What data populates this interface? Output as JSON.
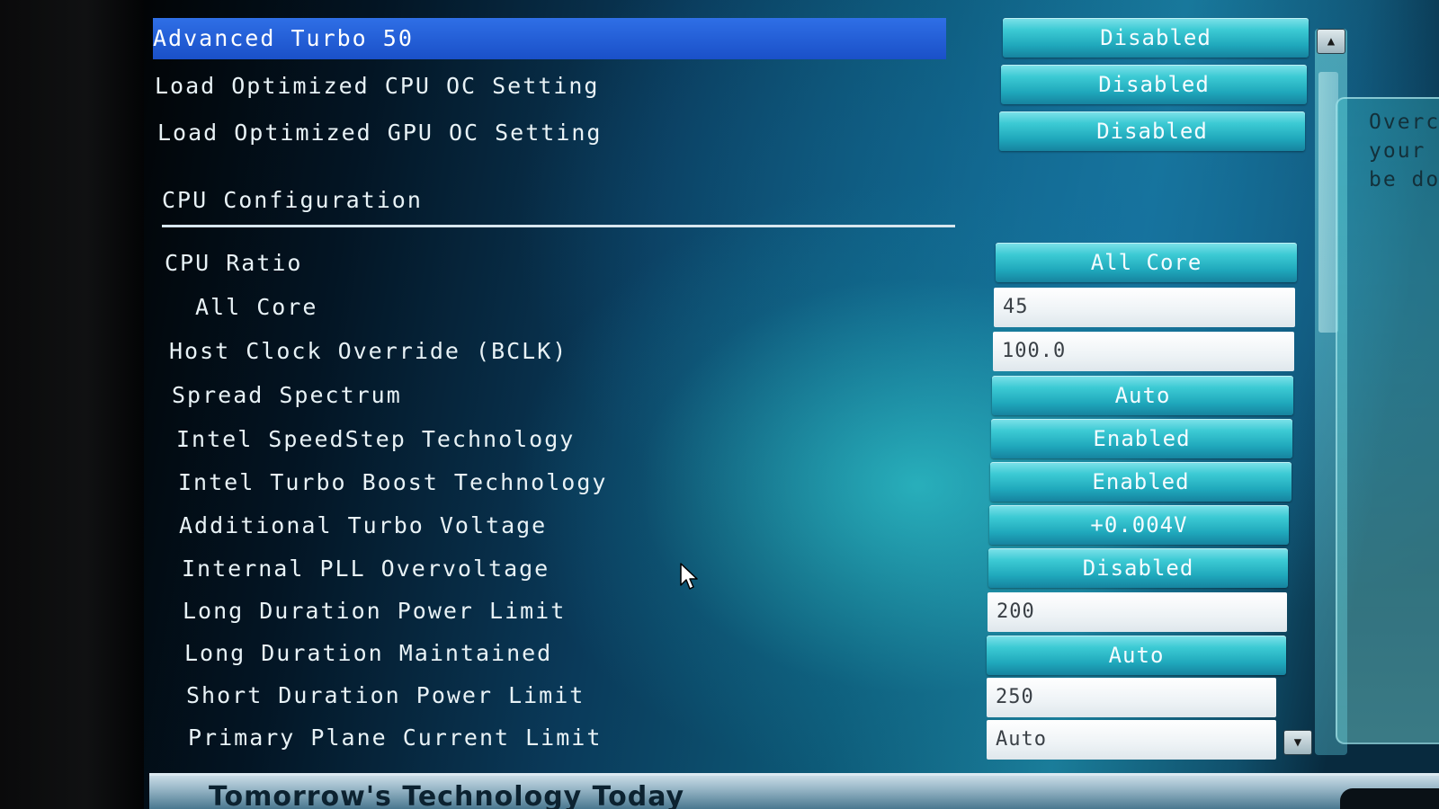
{
  "selected_row": {
    "label": "Advanced Turbo 50",
    "value": "Disabled"
  },
  "top_rows": [
    {
      "label": "Load Optimized CPU OC Setting",
      "value": "Disabled"
    },
    {
      "label": "Load Optimized GPU OC Setting",
      "value": "Disabled"
    }
  ],
  "section": {
    "title": "CPU Configuration"
  },
  "cpu_rows": [
    {
      "label": "CPU Ratio",
      "value": "All Core",
      "kind": "button"
    },
    {
      "label": "All Core",
      "value": "45",
      "kind": "field"
    },
    {
      "label": "Host Clock Override (BCLK)",
      "value": "100.0",
      "kind": "field"
    },
    {
      "label": "Spread Spectrum",
      "value": "Auto",
      "kind": "button"
    },
    {
      "label": "Intel SpeedStep Technology",
      "value": "Enabled",
      "kind": "button"
    },
    {
      "label": "Intel Turbo Boost Technology",
      "value": "Enabled",
      "kind": "button"
    },
    {
      "label": "Additional Turbo Voltage",
      "value": "+0.004V",
      "kind": "button"
    },
    {
      "label": "Internal PLL Overvoltage",
      "value": "Disabled",
      "kind": "button"
    },
    {
      "label": "Long Duration Power Limit",
      "value": "200",
      "kind": "field"
    },
    {
      "label": "Long Duration Maintained",
      "value": "Auto",
      "kind": "button"
    },
    {
      "label": "Short Duration Power Limit",
      "value": "250",
      "kind": "field"
    },
    {
      "label": "Primary Plane Current Limit",
      "value": "Auto",
      "kind": "field"
    }
  ],
  "help_panel": {
    "text": "Overc\nyour \nbe do"
  },
  "footer": {
    "tagline": "Tomorrow's Technology Today"
  },
  "scrollbar": {
    "up_icon": "▲",
    "down_icon": "▼"
  },
  "colors": {
    "selection": "#2f6fe6",
    "button": "#1fa7bb",
    "field": "#eef3f6"
  }
}
